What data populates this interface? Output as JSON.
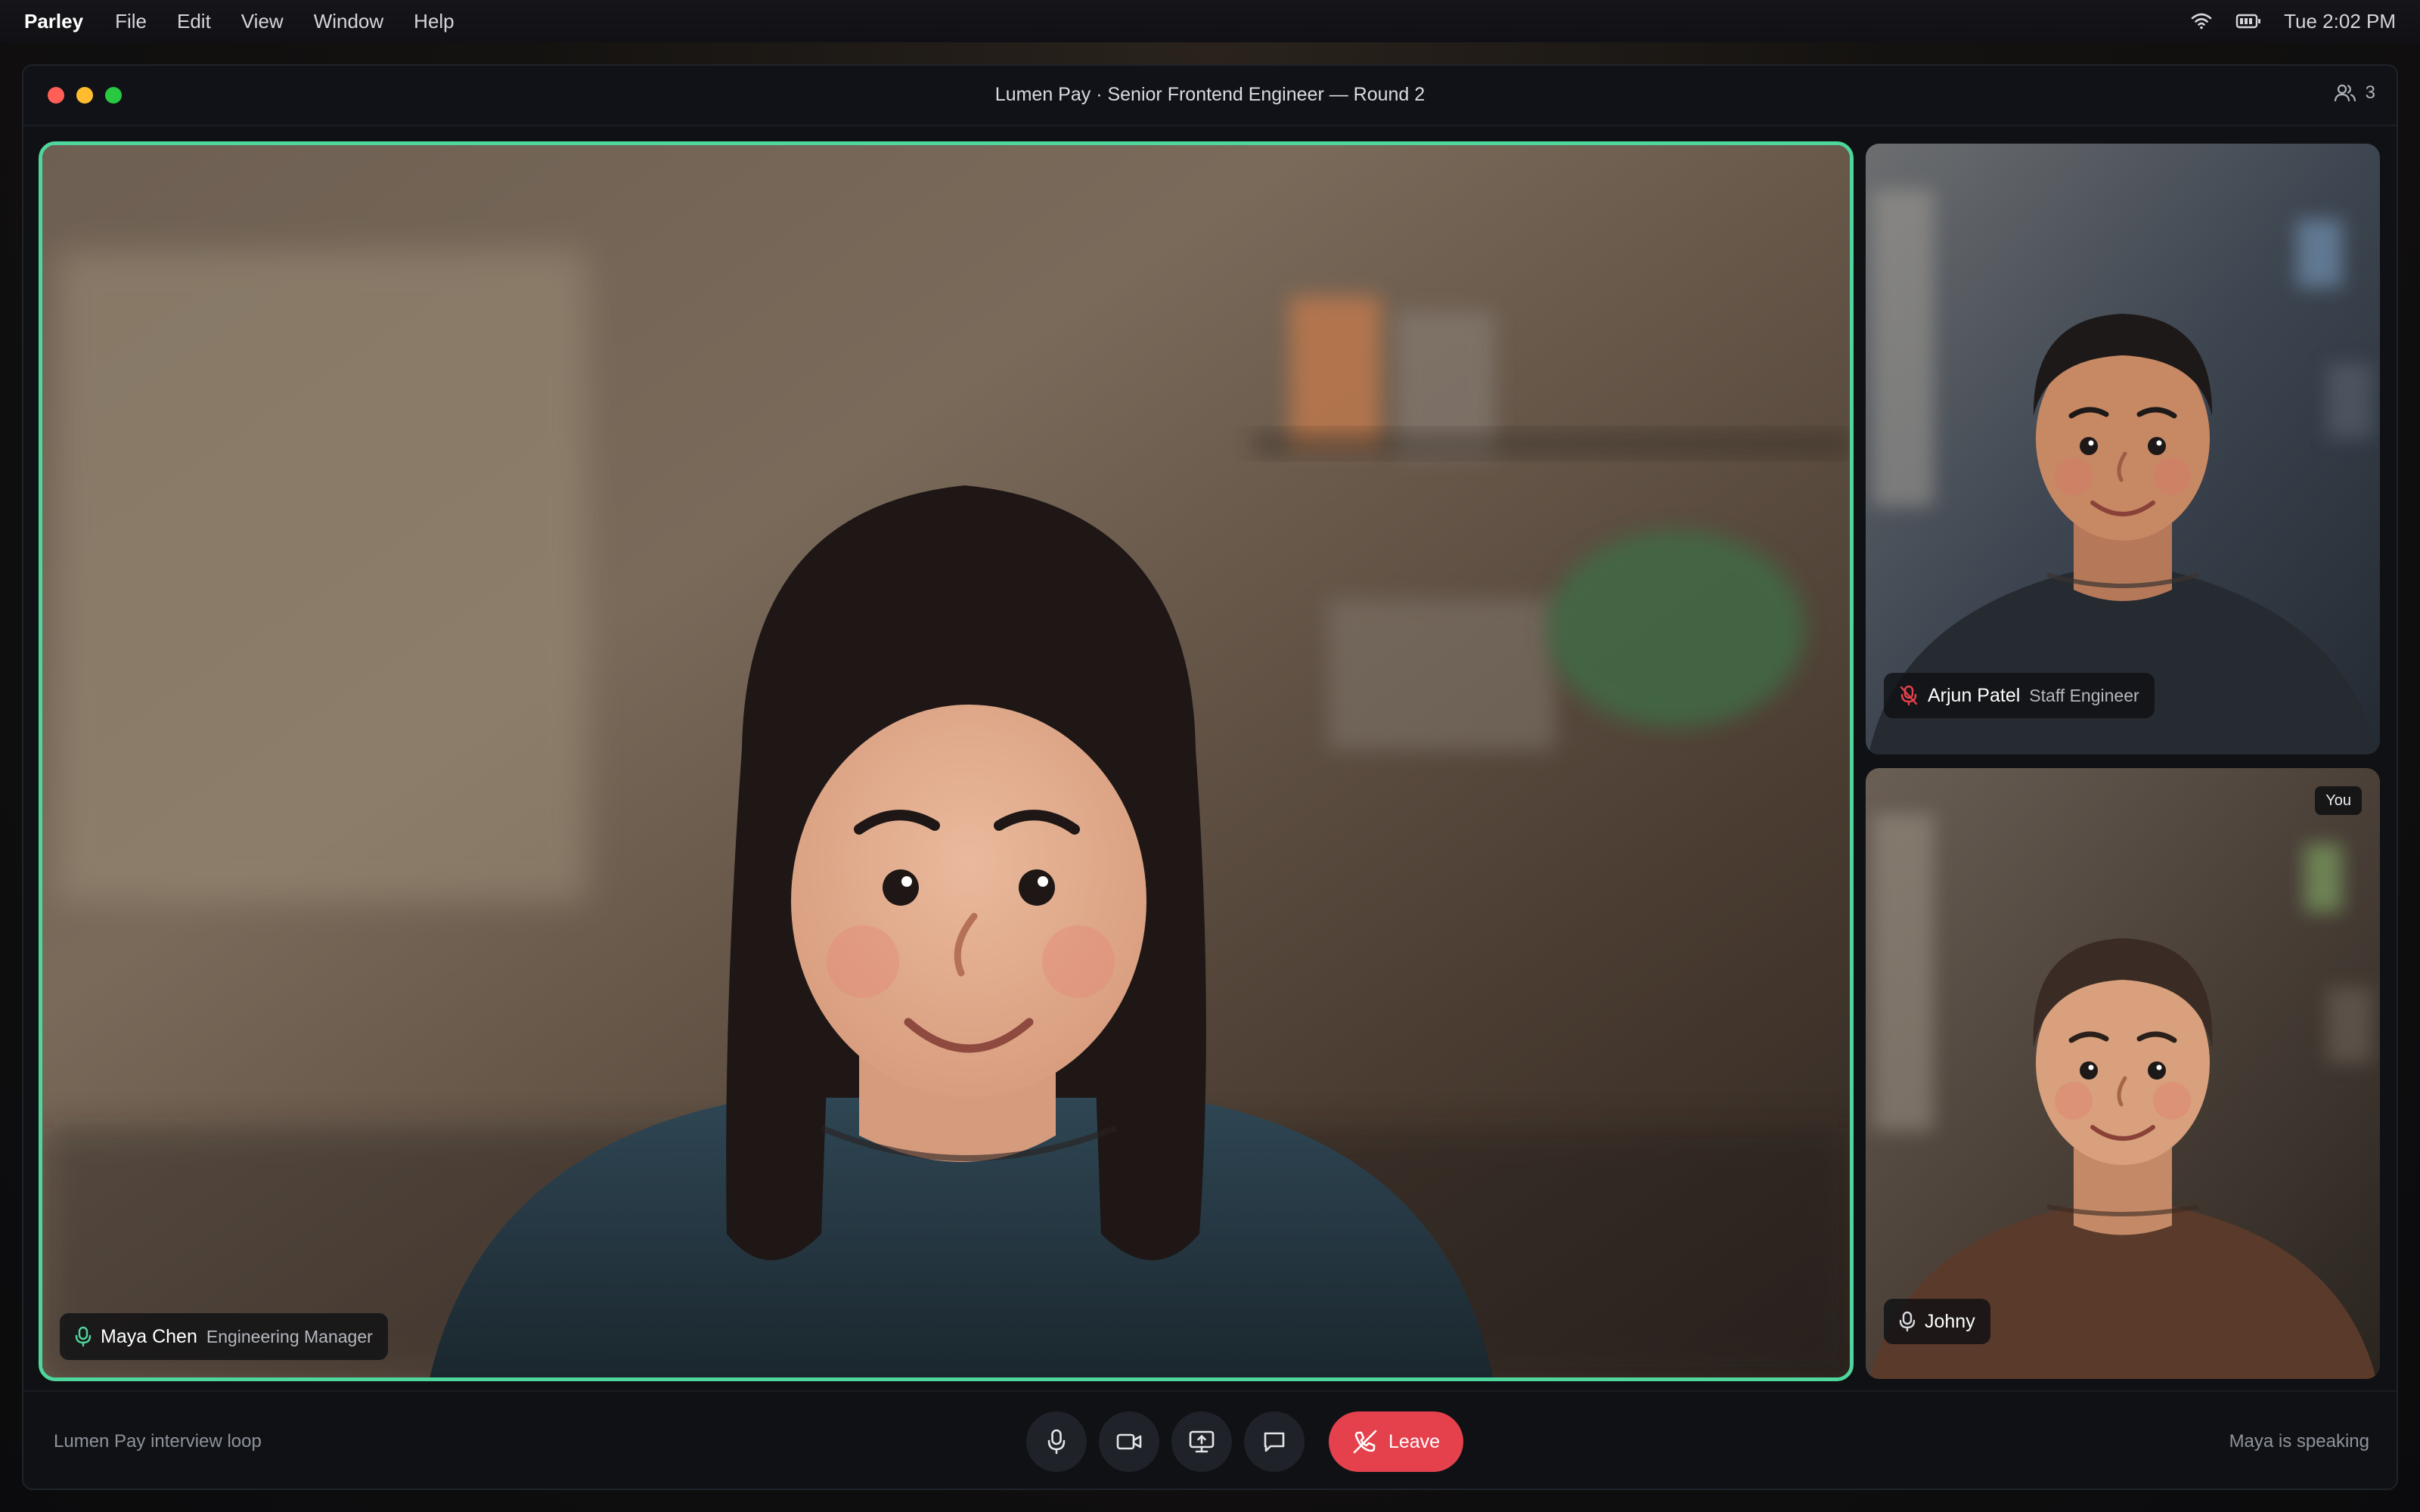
{
  "menubar": {
    "app_name": "Parley",
    "menus": [
      "File",
      "Edit",
      "View",
      "Window",
      "Help"
    ],
    "clock": "Tue 2:02 PM",
    "icons": [
      "wifi-icon",
      "battery-icon"
    ]
  },
  "window": {
    "title": "Lumen Pay · Senior Frontend Engineer — Round 2",
    "participant_count": "3",
    "traffic_lights": {
      "close": "#ff5f57",
      "minimize": "#febc2e",
      "zoom": "#28c840"
    }
  },
  "tiles": {
    "main": {
      "name": "Maya Chen",
      "role": "Engineering Manager",
      "mic": "on",
      "speaking": true
    },
    "arjun": {
      "name": "Arjun Patel",
      "role": "Staff Engineer",
      "mic": "muted"
    },
    "self": {
      "name": "Johny",
      "badge": "You",
      "mic": "on"
    }
  },
  "controls": {
    "left_text": "Lumen Pay interview loop",
    "right_text": "Maya is speaking",
    "leave_label": "Leave",
    "buttons": [
      "microphone-icon",
      "camera-icon",
      "share-screen-icon",
      "chat-icon"
    ]
  },
  "colors": {
    "speaking_border": "#4fd69c",
    "leave_button": "#e5414d",
    "muted_icon": "#e5414d",
    "mic_on_icon": "#4fd69c"
  }
}
